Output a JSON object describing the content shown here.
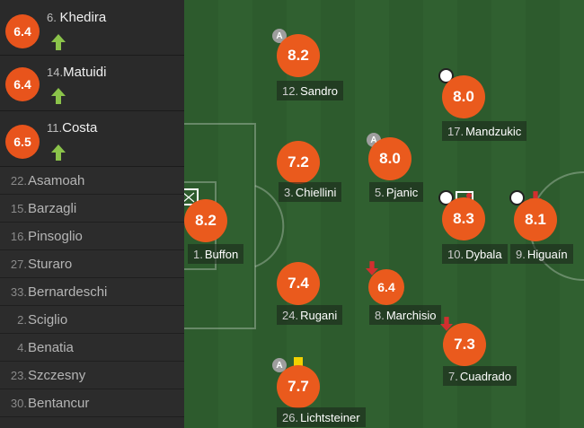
{
  "substitutes_in": [
    {
      "rating": "6.4",
      "number": "6.",
      "name": "Khedira"
    },
    {
      "rating": "6.4",
      "number": "14.",
      "name": "Matuidi"
    },
    {
      "rating": "6.5",
      "number": "11.",
      "name": "Costa"
    }
  ],
  "bench": [
    {
      "number": "22.",
      "name": "Asamoah"
    },
    {
      "number": "15.",
      "name": "Barzagli"
    },
    {
      "number": "16.",
      "name": "Pinsoglio"
    },
    {
      "number": "27.",
      "name": "Sturaro"
    },
    {
      "number": "33.",
      "name": "Bernardeschi"
    },
    {
      "number": "2.",
      "name": "Sciglio"
    },
    {
      "number": "4.",
      "name": "Benatia"
    },
    {
      "number": "23.",
      "name": "Szczesny"
    },
    {
      "number": "30.",
      "name": "Bentancur"
    }
  ],
  "players": {
    "buffon": {
      "rating": "8.2",
      "number": "1.",
      "name": "Buffon"
    },
    "sandro": {
      "rating": "8.2",
      "number": "12.",
      "name": "Sandro"
    },
    "chiellini": {
      "rating": "7.2",
      "number": "3.",
      "name": "Chiellini"
    },
    "rugani": {
      "rating": "7.4",
      "number": "24.",
      "name": "Rugani"
    },
    "lichtsteiner": {
      "rating": "7.7",
      "number": "26.",
      "name": "Lichtsteiner"
    },
    "pjanic": {
      "rating": "8.0",
      "number": "5.",
      "name": "Pjanic"
    },
    "marchisio": {
      "rating": "6.4",
      "number": "8.",
      "name": "Marchisio"
    },
    "mandzukic": {
      "rating": "8.0",
      "number": "17.",
      "name": "Mandzukic"
    },
    "dybala": {
      "rating": "8.3",
      "number": "10.",
      "name": "Dybala"
    },
    "cuadrado": {
      "rating": "7.3",
      "number": "7.",
      "name": "Cuadrado"
    },
    "higuain": {
      "rating": "8.1",
      "number": "9.",
      "name": "Higuaín"
    }
  },
  "icons": {
    "assist": "A",
    "sub_in": "green-up-arrow-icon",
    "sub_out": "red-down-arrow-icon",
    "goal": "soccer-ball-icon",
    "yellow_card": "yellow-card-icon",
    "clean_sheet": "goal-net-icon"
  },
  "colors": {
    "rating_badge": "#ea5a1d",
    "sub_in_arrow": "#8bc34a",
    "sub_out_arrow": "#d32f2f",
    "yellow_card": "#f2d100"
  }
}
